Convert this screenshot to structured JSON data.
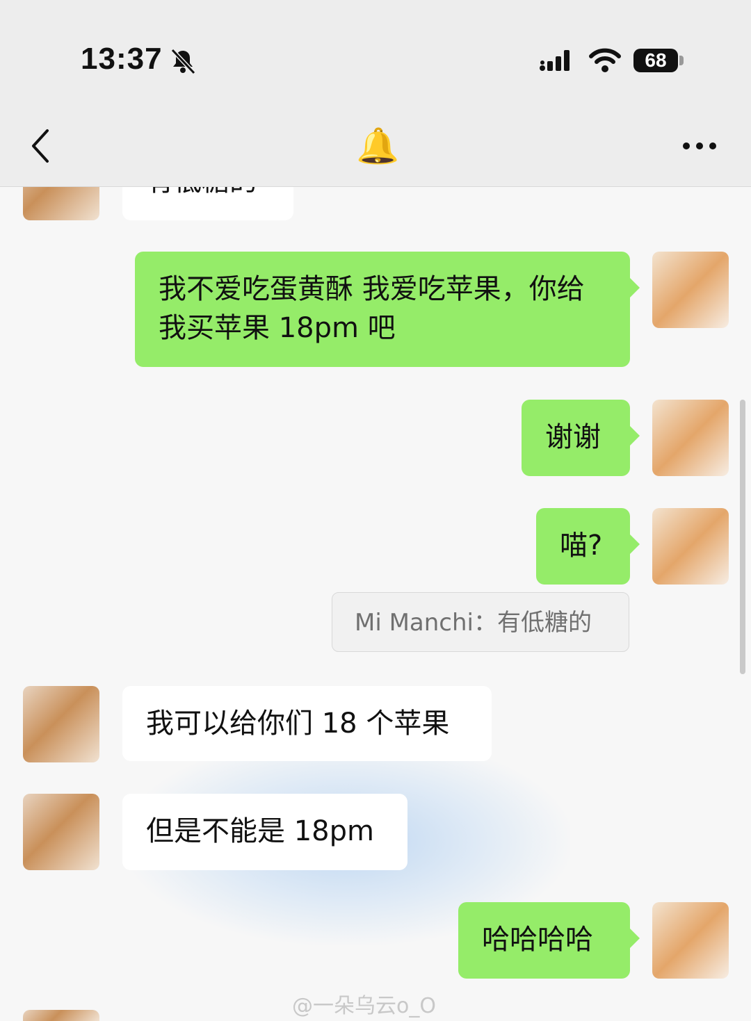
{
  "status_bar": {
    "time": "13:37",
    "battery": "68",
    "icons": [
      "bell-slash-icon",
      "signal-icon",
      "wifi-icon",
      "battery-icon"
    ]
  },
  "nav": {
    "title_emoji": "🔔",
    "back_icon": "chevron-left-icon",
    "more_icon": "more-dots-icon"
  },
  "messages": [
    {
      "from": "friend",
      "text": "有低糖的",
      "partial": true
    },
    {
      "from": "self",
      "text": "我不爱吃蛋黄酥 我爱吃苹果，你给我买苹果 18pm 吧"
    },
    {
      "from": "self",
      "text": "谢谢"
    },
    {
      "from": "self",
      "text": "喵?"
    },
    {
      "from": "quote",
      "text": "Mi Manchi：有低糖的"
    },
    {
      "from": "friend",
      "text": "我可以给你们 18 个苹果"
    },
    {
      "from": "friend",
      "text": "但是不能是 18pm"
    },
    {
      "from": "self",
      "text": "哈哈哈哈"
    }
  ],
  "watermark": "@一朵乌云o_O",
  "colors": {
    "outgoing_bubble": "#95ec69",
    "incoming_bubble": "#ffffff",
    "background": "#f7f7f7",
    "topbar": "#ededed"
  }
}
